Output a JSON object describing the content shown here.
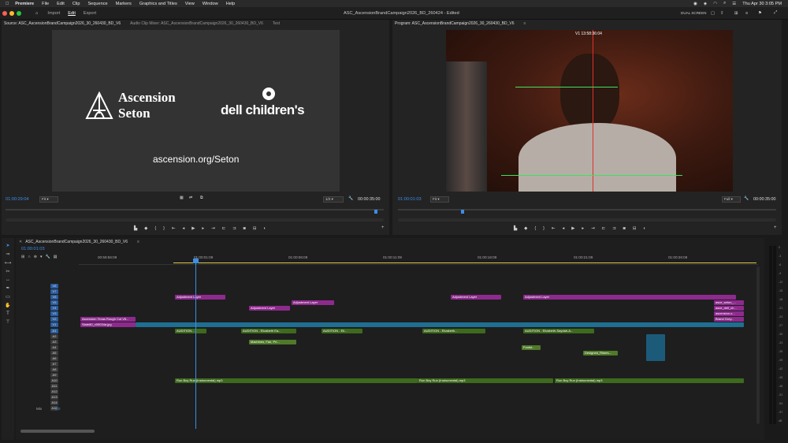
{
  "menubar": {
    "app": "Premiere",
    "items": [
      "File",
      "Edit",
      "Clip",
      "Sequence",
      "Markers",
      "Graphics and Titles",
      "View",
      "Window",
      "Help"
    ],
    "clock": "Thu Apr 30  3:05 PM"
  },
  "appbar": {
    "tabs": [
      "Import",
      "Edit",
      "Export"
    ],
    "title": "ASC_AscensionBrandCampaign2026_BD_260424 - Edited",
    "workspace": "DUAL SCREEN"
  },
  "source": {
    "tabs": [
      "Source: ASC_AscensionBrandCampaign2026_30_260430_BD_V6",
      "Audio Clip Mixer: ASC_AscensionBrandCampaign2026_30_260430_BD_V6",
      "Text"
    ],
    "brand1_line1": "Ascension",
    "brand1_line2": "Seton",
    "brand2": "dell children's",
    "url": "ascension.org/Seton",
    "timecode": "01:00:29:04",
    "fit": "Fit",
    "resolution": "1/2",
    "duration": "00:00:35:00"
  },
  "program": {
    "tab": "Program: ASC_AscensionBrandCampaign2026_30_260430_BD_V6",
    "overlay_tc": "V1  13:58:36:04",
    "timecode": "01:00:01:03",
    "fit": "Fit",
    "resolution": "Full",
    "duration": "00:00:35:00"
  },
  "timeline": {
    "tab": "ASC_AscensionBrandCampaign2026_30_260430_BD_V6",
    "timecode": "01:00:01:03",
    "ruler": [
      "00:59:56:09",
      "01:00:01:09",
      "01:00:06:09",
      "01:00:11:09",
      "01:00:16:09",
      "01:00:21:09",
      "01:00:26:08"
    ],
    "video_tracks": [
      "V8",
      "V7",
      "V6",
      "V5",
      "V4",
      "V3",
      "V2",
      "V1"
    ],
    "audio_tracks": [
      "A1",
      "A2",
      "A3",
      "A4",
      "A5",
      "A6",
      "A7",
      "A8",
      "A9",
      "A10",
      "A11",
      "A12",
      "A13",
      "A14",
      "A15"
    ],
    "mix_label": "Mix",
    "mix_value": "0.0",
    "clips": {
      "adj1": "Adjustment Layer",
      "adj2": "Adjustment Layer",
      "adj3": "Adjustment Layer",
      "adj4": "Adjustment Layer",
      "adj5": "Adjustment Layer",
      "v2a": "Ascension Texas Rough Cut V6...",
      "v2b": "Slate80_v09034a.jpg",
      "a1a": "AUDITION...",
      "a1b": "AUDITION - Elizabeth Ea...",
      "a1c": "AUDITION - Eli...",
      "a1d": "AUDITION - Elizabeth...",
      "a1e": "AUDITION - Elizabeth-Saydah-A...",
      "a3": "Machines, Fan, Pri...",
      "a4a": "Footst...",
      "a4b": "Designed_Risers...",
      "a10a": "Run Boy Run (Instrumental).mp3",
      "a10b": "Run Boy Run (Instrumental).mp3",
      "a10c": "Run Boy Run (Instrumental).mp3",
      "v6r1": "asce_seton_...",
      "v6r2": "asce_dell_ch...",
      "v6r3": "ascension.o...",
      "v6r4": "Brand Grey..."
    }
  },
  "meter": [
    "0",
    "-3",
    "-6",
    "-9",
    "-12",
    "-15",
    "-18",
    "-21",
    "-24",
    "-27",
    "-30",
    "-33",
    "-36",
    "-39",
    "-42",
    "-45",
    "-48",
    "-51",
    "-54",
    "-57",
    "dB"
  ],
  "colors": {
    "accent": "#3b8eea",
    "adjustment": "#8e2a8e",
    "video": "#1f6f92",
    "audio": "#3d6a1d",
    "playhead": "#3b8eea"
  }
}
